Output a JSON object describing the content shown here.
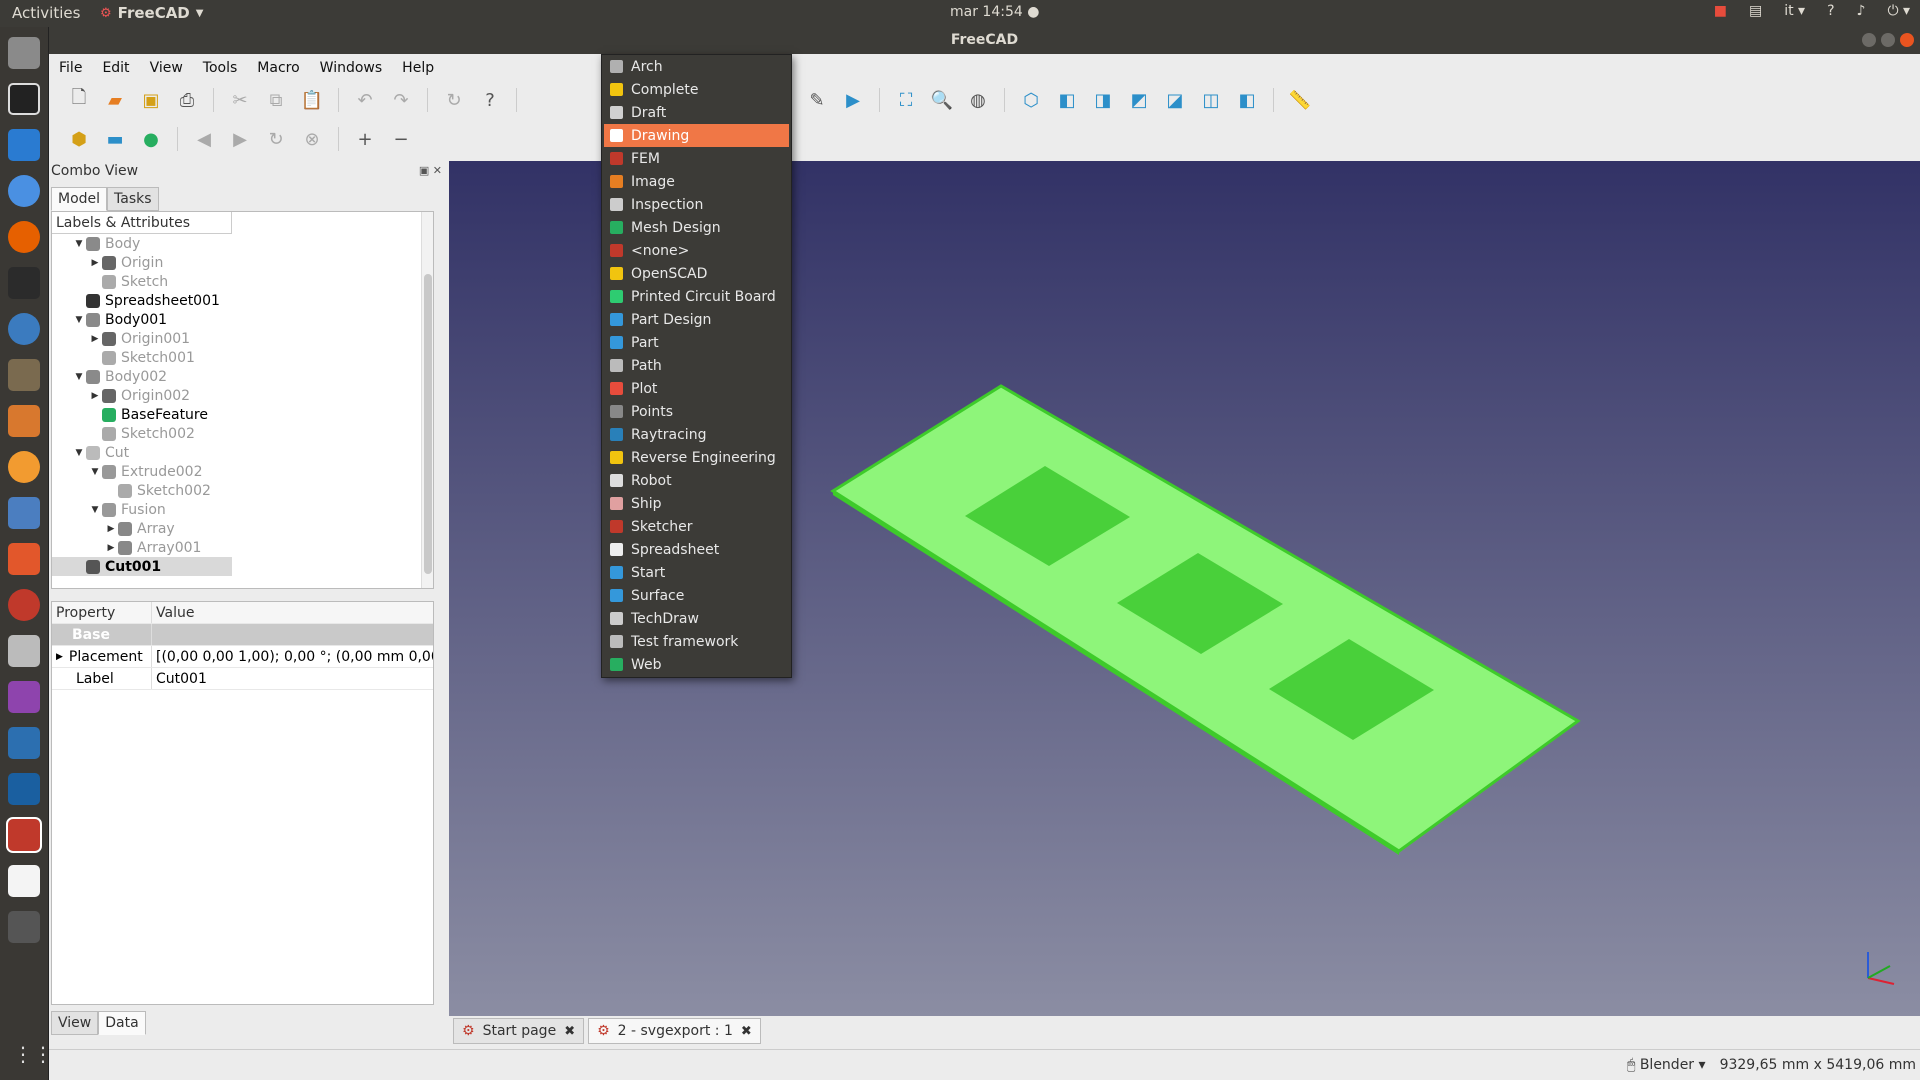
{
  "system": {
    "activities": "Activities",
    "app_name": "FreeCAD",
    "clock": "mar 14:54 ●",
    "lang": "it",
    "help": "?"
  },
  "window": {
    "title": "FreeCAD"
  },
  "menubar": {
    "items": [
      "File",
      "Edit",
      "View",
      "Tools",
      "Macro",
      "Windows",
      "Help"
    ]
  },
  "combo": {
    "title": "Combo View",
    "tabs": [
      "Model",
      "Tasks"
    ],
    "tree_header": "Labels & Attributes",
    "tree": [
      {
        "label": "Body",
        "indent": 1,
        "arrow": "▼",
        "style": "dim",
        "icon": "body-icon"
      },
      {
        "label": "Origin",
        "indent": 2,
        "arrow": "▶",
        "style": "dim",
        "icon": "origin-icon"
      },
      {
        "label": "Sketch",
        "indent": 2,
        "arrow": "",
        "style": "dim",
        "icon": "sketch-icon"
      },
      {
        "label": "Spreadsheet001",
        "indent": 1,
        "arrow": "",
        "style": "dark",
        "icon": "spreadsheet-icon"
      },
      {
        "label": "Body001",
        "indent": 1,
        "arrow": "▼",
        "style": "dark",
        "icon": "body-icon"
      },
      {
        "label": "Origin001",
        "indent": 2,
        "arrow": "▶",
        "style": "dim",
        "icon": "origin-icon"
      },
      {
        "label": "Sketch001",
        "indent": 2,
        "arrow": "",
        "style": "dim",
        "icon": "sketch-icon"
      },
      {
        "label": "Body002",
        "indent": 1,
        "arrow": "▼",
        "style": "dim",
        "icon": "body-icon"
      },
      {
        "label": "Origin002",
        "indent": 2,
        "arrow": "▶",
        "style": "dim",
        "icon": "origin-icon"
      },
      {
        "label": "BaseFeature",
        "indent": 2,
        "arrow": "",
        "style": "dark",
        "icon": "feature-icon"
      },
      {
        "label": "Sketch002",
        "indent": 2,
        "arrow": "",
        "style": "dim",
        "icon": "sketch-icon"
      },
      {
        "label": "Cut",
        "indent": 1,
        "arrow": "▼",
        "style": "dim",
        "icon": "cut-icon"
      },
      {
        "label": "Extrude002",
        "indent": 2,
        "arrow": "▼",
        "style": "dim",
        "icon": "extrude-icon"
      },
      {
        "label": "Sketch002",
        "indent": 3,
        "arrow": "",
        "style": "dim",
        "icon": "sketch-icon"
      },
      {
        "label": "Fusion",
        "indent": 2,
        "arrow": "▼",
        "style": "dim",
        "icon": "fusion-icon"
      },
      {
        "label": "Array",
        "indent": 3,
        "arrow": "▶",
        "style": "dim",
        "icon": "array-icon"
      },
      {
        "label": "Array001",
        "indent": 3,
        "arrow": "▶",
        "style": "dim",
        "icon": "array-icon"
      },
      {
        "label": "Cut001",
        "indent": 1,
        "arrow": "",
        "style": "sel",
        "icon": "solid-icon"
      }
    ],
    "props": {
      "col_property": "Property",
      "col_value": "Value",
      "group": "Base",
      "rows": [
        {
          "name": "Placement",
          "value": "[(0,00 0,00 1,00); 0,00 °; (0,00 mm  0,00 ...",
          "expand": "▶"
        },
        {
          "name": "Label",
          "value": "Cut001",
          "expand": ""
        }
      ]
    },
    "bottom_tabs": [
      "View",
      "Data"
    ]
  },
  "workbench_menu": {
    "items": [
      {
        "label": "Arch",
        "color": "#b0b0b0"
      },
      {
        "label": "Complete",
        "color": "#f1c40f"
      },
      {
        "label": "Draft",
        "color": "#d0d0d0"
      },
      {
        "label": "Drawing",
        "color": "#ffffff",
        "highlighted": true
      },
      {
        "label": "FEM",
        "color": "#c0392b"
      },
      {
        "label": "Image",
        "color": "#e67e22"
      },
      {
        "label": "Inspection",
        "color": "#cccccc"
      },
      {
        "label": "Mesh Design",
        "color": "#27ae60"
      },
      {
        "label": "<none>",
        "color": "#c0392b"
      },
      {
        "label": "OpenSCAD",
        "color": "#f1c40f"
      },
      {
        "label": "Printed Circuit Board",
        "color": "#2ecc71"
      },
      {
        "label": "Part Design",
        "color": "#3498db"
      },
      {
        "label": "Part",
        "color": "#3498db"
      },
      {
        "label": "Path",
        "color": "#bbbbbb"
      },
      {
        "label": "Plot",
        "color": "#e74c3c"
      },
      {
        "label": "Points",
        "color": "#888888"
      },
      {
        "label": "Raytracing",
        "color": "#2980b9"
      },
      {
        "label": "Reverse Engineering",
        "color": "#f1c40f"
      },
      {
        "label": "Robot",
        "color": "#dddddd"
      },
      {
        "label": "Ship",
        "color": "#e0a0a0"
      },
      {
        "label": "Sketcher",
        "color": "#c0392b"
      },
      {
        "label": "Spreadsheet",
        "color": "#eeeeee"
      },
      {
        "label": "Start",
        "color": "#3498db"
      },
      {
        "label": "Surface",
        "color": "#3498db"
      },
      {
        "label": "TechDraw",
        "color": "#cccccc"
      },
      {
        "label": "Test framework",
        "color": "#bbbbbb"
      },
      {
        "label": "Web",
        "color": "#27ae60"
      }
    ]
  },
  "doc_tabs": [
    {
      "label": "Start page",
      "active": false
    },
    {
      "label": "2 - svgexport : 1",
      "active": true
    }
  ],
  "status": {
    "nav_style": "Blender",
    "dimensions": "9329,65 mm x 5419,06 mm"
  },
  "colors": {
    "highlight": "#f07746",
    "model_green": "#8ef57a",
    "model_edge": "#3ecb2a"
  }
}
